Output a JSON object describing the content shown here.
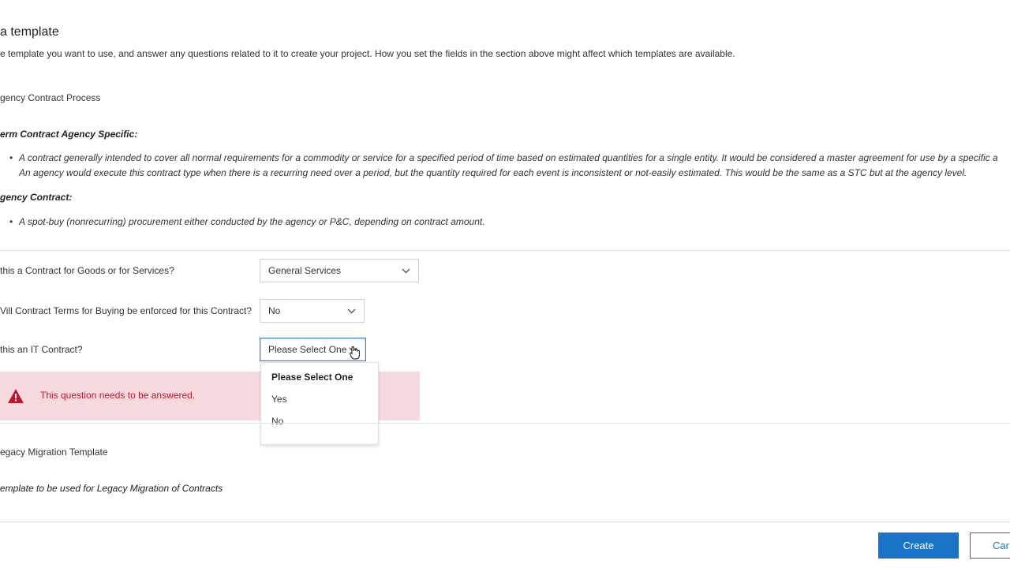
{
  "section": {
    "title": "a template",
    "description": "e template you want to use, and answer any questions related to it to create your project. How you set the fields in the section above might affect which templates are available."
  },
  "template1": {
    "name": "gency Contract Process",
    "definitions": [
      {
        "heading": "erm Contract Agency Specific:",
        "bullets": [
          "A contract generally intended to cover all normal requirements for a commodity or service for a specified period of time based on estimated quantities for a single entity. It would be considered a master agreement for use by a specific a",
          "An agency would execute this contract type when there is a recurring need over a period, but the quantity required for each event is inconsistent or not-easily estimated. This would be the same as a STC but at the agency level."
        ]
      },
      {
        "heading": "gency Contract:",
        "bullets": [
          "A spot-buy (nonrecurring) procurement either conducted by the agency or P&C, depending on contract amount."
        ]
      }
    ]
  },
  "questions": [
    {
      "label": "this a Contract for Goods or for Services?",
      "value": "General Services"
    },
    {
      "label": "Vill Contract Terms for Buying be enforced for this Contract?",
      "value": "No"
    },
    {
      "label": "this an IT Contract?",
      "value": "Please Select One"
    }
  ],
  "error": {
    "message": "This question needs to be answered.",
    "color": "#c0152f"
  },
  "dropdown": {
    "options": [
      "Please Select One",
      "Yes",
      "No"
    ],
    "selected": "Please Select One"
  },
  "template2": {
    "name": "egacy Migration Template",
    "description": "emplate to be used for Legacy Migration of Contracts"
  },
  "buttons": {
    "create": "Create",
    "cancel": "Car"
  },
  "colors": {
    "accent": "#1a73c6",
    "error_bg": "#f5d9dc"
  }
}
